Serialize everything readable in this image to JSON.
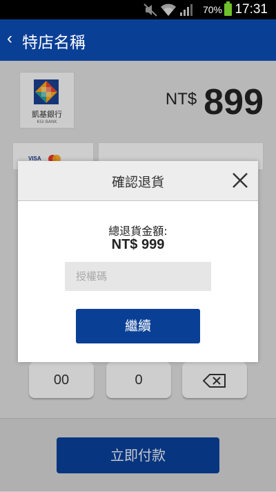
{
  "status_bar": {
    "time": "17:31",
    "battery_percent": "70%",
    "battery_level": 0.7,
    "icons": [
      "mute-icon",
      "wifi-icon",
      "signal-icon",
      "battery-icon"
    ]
  },
  "header": {
    "back_icon": "‹",
    "title": "特店名稱"
  },
  "bank": {
    "name": "凱基銀行",
    "name_en": "KGI BANK"
  },
  "amount": {
    "currency": "NT$",
    "value": "899"
  },
  "card": {
    "visa_label": "VISA"
  },
  "keypad": {
    "keys": [
      "00",
      "0"
    ],
    "backspace_icon": "backspace-icon"
  },
  "pay_button": "立即付款",
  "modal": {
    "title": "確認退貨",
    "refund_label": "總退貨金額:",
    "refund_amount": "NT$ 999",
    "auth_placeholder": "授權碼",
    "auth_value": "",
    "continue_label": "繼續"
  },
  "colors": {
    "primary": "#0a3f96",
    "status_bar": "#000000",
    "battery": "#6fc02b"
  }
}
